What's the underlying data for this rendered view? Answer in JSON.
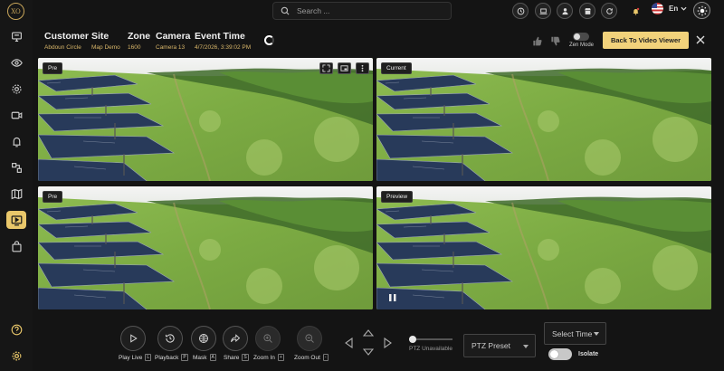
{
  "app": {
    "logo_text": "XO"
  },
  "sidebar": {
    "items": [
      {
        "name": "monitor",
        "active": false
      },
      {
        "name": "eye",
        "active": false
      },
      {
        "name": "gear",
        "active": false
      },
      {
        "name": "camera",
        "active": false
      },
      {
        "name": "alarm",
        "active": false
      },
      {
        "name": "nodes",
        "active": false
      },
      {
        "name": "map",
        "active": false
      },
      {
        "name": "video-viewer",
        "active": true
      },
      {
        "name": "bag",
        "active": false
      }
    ],
    "bottom": [
      "help",
      "settings"
    ]
  },
  "search": {
    "placeholder": "Search ..."
  },
  "topbar": {
    "buttons": [
      "clock",
      "laptop",
      "user",
      "store",
      "refresh",
      "notification"
    ],
    "language": "En"
  },
  "event": {
    "customer_label": "Customer",
    "customer_value": "Abdoun Circle",
    "site_label": "Site",
    "site_value": "Map Demo",
    "zone_label": "Zone",
    "zone_value": "1600",
    "camera_label": "Camera",
    "camera_value": "Camera 13",
    "time_label": "Event Time",
    "time_value": "4/7/2026, 3:39:02 PM"
  },
  "actions": {
    "zen_mode_label": "Zen Mode",
    "back_label": "Back To Video Viewer"
  },
  "panels": [
    {
      "label": "Pre"
    },
    {
      "label": "Current"
    },
    {
      "label": "Pre"
    },
    {
      "label": "Preview"
    }
  ],
  "controls": {
    "play_live": "Play Live",
    "play_live_key": "L",
    "playback": "Playback",
    "playback_key": "P",
    "mask": "Mask",
    "mask_key": "A",
    "share": "Share",
    "share_key": "S",
    "zoom_in": "Zoom In",
    "zoom_in_key": "+",
    "zoom_out": "Zoom Out",
    "zoom_out_key": "-",
    "ptz_unavailable": "PTZ Unavailable",
    "ptz_preset": "PTZ Preset",
    "select_time": "Select Time",
    "isolate": "Isolate"
  },
  "colors": {
    "accent": "#f2d27b",
    "background": "#141414"
  }
}
